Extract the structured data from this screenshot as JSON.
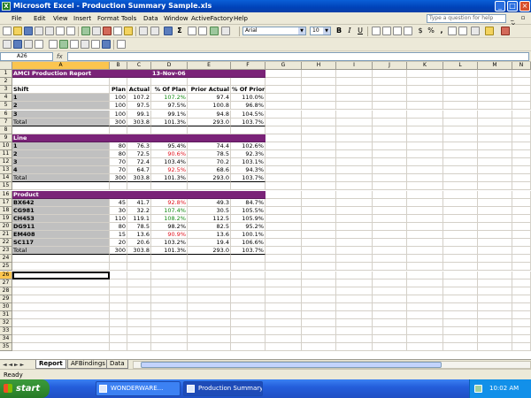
{
  "window": {
    "title": "Microsoft Excel - Production Summary Sample.xls"
  },
  "menu": {
    "items": [
      {
        "label": "File"
      },
      {
        "label": "Edit"
      },
      {
        "label": "View"
      },
      {
        "label": "Insert"
      },
      {
        "label": "Format"
      },
      {
        "label": "Tools"
      },
      {
        "label": "Data"
      },
      {
        "label": "Window"
      },
      {
        "label": "ActiveFactory"
      },
      {
        "label": "Help"
      }
    ],
    "help_placeholder": "Type a question for help"
  },
  "toolbar": {
    "font": "Arial",
    "font_size": "10",
    "bold": "B",
    "italic": "I",
    "underline": "U",
    "currency": "$",
    "percent": "%",
    "comma": ",",
    "sigma": "Σ"
  },
  "formula_bar": {
    "name_box": "A26",
    "fx": "fx",
    "content": ""
  },
  "columns": [
    "A",
    "B",
    "C",
    "D",
    "E",
    "F",
    "G",
    "H",
    "I",
    "J",
    "K",
    "L",
    "M",
    "N"
  ],
  "active_column": "A",
  "active_row": 26,
  "row_numbers": [
    1,
    2,
    3,
    4,
    5,
    6,
    7,
    8,
    9,
    10,
    11,
    12,
    13,
    14,
    15,
    16,
    17,
    18,
    19,
    20,
    21,
    22,
    23,
    24,
    25,
    26,
    27,
    28,
    29,
    30,
    31,
    32,
    33,
    34,
    35
  ],
  "sheet": {
    "r1": {
      "A": "AMCI Production Report",
      "D": "13-Nov-06"
    },
    "r3": {
      "A": "Shift",
      "B": "Plan",
      "C": "Actual",
      "D": "% Of Plan",
      "E": "Prior Actual",
      "F": "% Of Prior"
    },
    "shift_rows": [
      {
        "row": 4,
        "A": "1",
        "B": "100",
        "C": "107.2",
        "D": "107.2%",
        "D_color": "green",
        "E": "97.4",
        "F": "110.0%"
      },
      {
        "row": 5,
        "A": "2",
        "B": "100",
        "C": "97.5",
        "D": "97.5%",
        "D_color": "black",
        "E": "100.8",
        "F": "96.8%"
      },
      {
        "row": 6,
        "A": "3",
        "B": "100",
        "C": "99.1",
        "D": "99.1%",
        "D_color": "black",
        "E": "94.8",
        "F": "104.5%"
      }
    ],
    "shift_total": {
      "row": 7,
      "A": "Total",
      "B": "300",
      "C": "303.8",
      "D": "101.3%",
      "E": "293.0",
      "F": "103.7%"
    },
    "r9": {
      "A": "Line"
    },
    "line_rows": [
      {
        "row": 10,
        "A": "1",
        "B": "80",
        "C": "76.3",
        "D": "95.4%",
        "D_color": "black",
        "E": "74.4",
        "F": "102.6%"
      },
      {
        "row": 11,
        "A": "2",
        "B": "80",
        "C": "72.5",
        "D": "90.6%",
        "D_color": "red",
        "E": "78.5",
        "F": "92.3%"
      },
      {
        "row": 12,
        "A": "3",
        "B": "70",
        "C": "72.4",
        "D": "103.4%",
        "D_color": "black",
        "E": "70.2",
        "F": "103.1%"
      },
      {
        "row": 13,
        "A": "4",
        "B": "70",
        "C": "64.7",
        "D": "92.5%",
        "D_color": "red",
        "E": "68.6",
        "F": "94.3%"
      }
    ],
    "line_total": {
      "row": 14,
      "A": "Total",
      "B": "300",
      "C": "303.8",
      "D": "101.3%",
      "E": "293.0",
      "F": "103.7%"
    },
    "r16": {
      "A": "Product"
    },
    "product_rows": [
      {
        "row": 17,
        "A": "BX642",
        "B": "45",
        "C": "41.7",
        "D": "92.8%",
        "D_color": "red",
        "E": "49.3",
        "F": "84.7%"
      },
      {
        "row": 18,
        "A": "CG981",
        "B": "30",
        "C": "32.2",
        "D": "107.4%",
        "D_color": "green",
        "E": "30.5",
        "F": "105.5%"
      },
      {
        "row": 19,
        "A": "CH453",
        "B": "110",
        "C": "119.1",
        "D": "108.2%",
        "D_color": "green",
        "E": "112.5",
        "F": "105.9%"
      },
      {
        "row": 20,
        "A": "DG911",
        "B": "80",
        "C": "78.5",
        "D": "98.2%",
        "D_color": "black",
        "E": "82.5",
        "F": "95.2%"
      },
      {
        "row": 21,
        "A": "EM408",
        "B": "15",
        "C": "13.6",
        "D": "90.9%",
        "D_color": "red",
        "E": "13.6",
        "F": "100.1%"
      },
      {
        "row": 22,
        "A": "SC117",
        "B": "20",
        "C": "20.6",
        "D": "103.2%",
        "D_color": "black",
        "E": "19.4",
        "F": "106.6%"
      }
    ],
    "product_total": {
      "row": 23,
      "A": "Total",
      "B": "300",
      "C": "303.8",
      "D": "101.3%",
      "E": "293.0",
      "F": "103.7%"
    }
  },
  "tabs": {
    "nav": "◄ ◄ ► ►",
    "sheets": [
      {
        "label": "Report"
      },
      {
        "label": "AFBindings"
      },
      {
        "label": "Data"
      }
    ],
    "active": "Report"
  },
  "status": {
    "text": "Ready"
  },
  "taskbar": {
    "start": "start",
    "tasks": [
      {
        "label": "WONDERWARE..."
      },
      {
        "label": "Production Summary ..."
      }
    ],
    "clock": "10:02 AM"
  },
  "colors": {
    "header_purple": "#7a2378",
    "label_gray": "#c0c0c0",
    "red": "#e0141e",
    "green": "#128a12"
  }
}
